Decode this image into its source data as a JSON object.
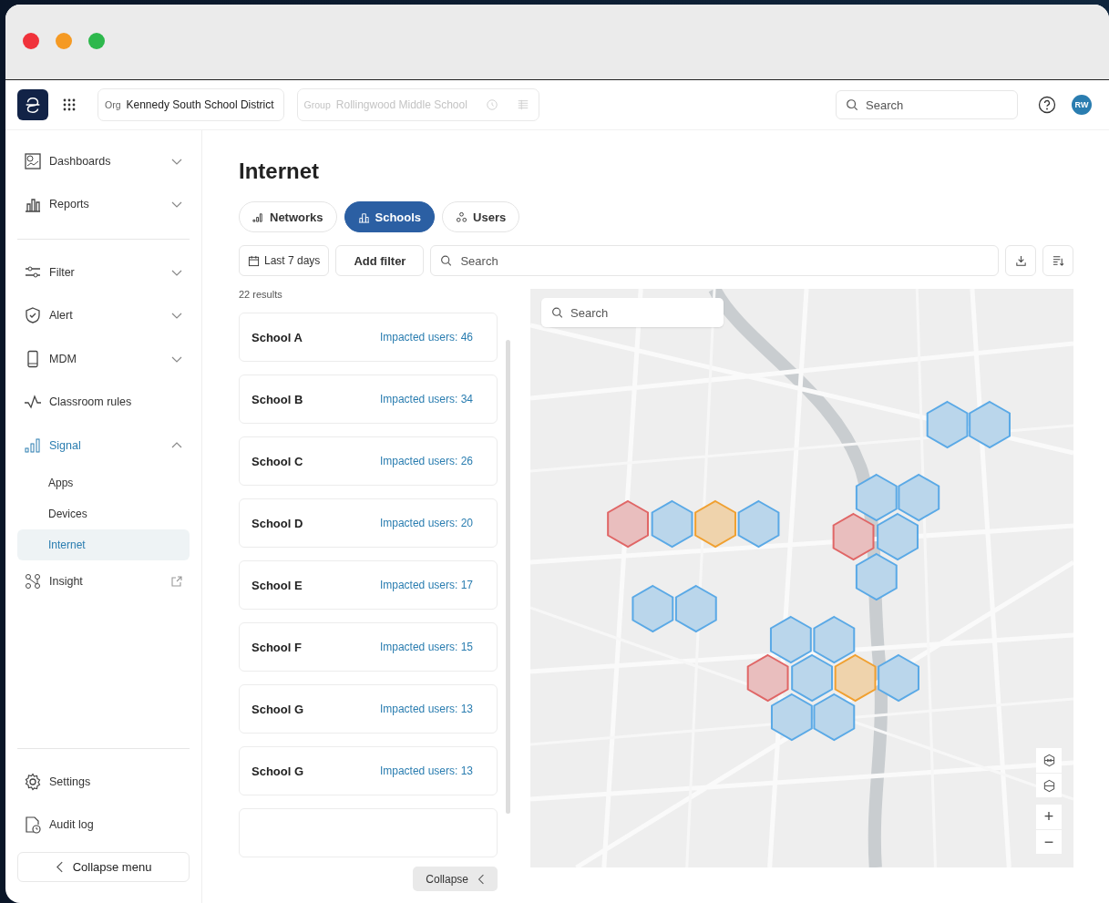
{
  "header": {
    "org": {
      "label": "Org",
      "value": "Kennedy South School District"
    },
    "group": {
      "label": "Group",
      "value": "Rollingwood Middle School",
      "disabled": true
    },
    "search": {
      "placeholder": "Search"
    },
    "avatar": "RW"
  },
  "sidebar": {
    "groups": [
      [
        {
          "label": "Dashboards",
          "kind": "dropdown",
          "expanded": false
        },
        {
          "label": "Reports",
          "kind": "dropdown",
          "expanded": false
        }
      ],
      [
        {
          "label": "Filter",
          "kind": "dropdown",
          "expanded": false
        },
        {
          "label": "Alert",
          "kind": "dropdown",
          "expanded": false
        },
        {
          "label": "MDM",
          "kind": "dropdown",
          "expanded": false
        },
        {
          "label": "Classroom rules",
          "kind": "plain"
        },
        {
          "label": "Signal",
          "kind": "dropdown",
          "expanded": true,
          "children": [
            {
              "label": "Apps",
              "selected": false
            },
            {
              "label": "Devices",
              "selected": false
            },
            {
              "label": "Internet",
              "selected": true
            }
          ]
        },
        {
          "label": "Insight",
          "kind": "external"
        }
      ]
    ],
    "footer": [
      {
        "label": "Settings"
      },
      {
        "label": "Audit log"
      }
    ],
    "collapse_button": "Collapse menu"
  },
  "page": {
    "title": "Internet",
    "tabs": [
      {
        "label": "Networks",
        "selected": false
      },
      {
        "label": "Schools",
        "selected": true
      },
      {
        "label": "Users",
        "selected": false
      }
    ],
    "toolbar": {
      "date_range": "Last 7 days",
      "add_filter": "Add filter",
      "search": {
        "placeholder": "Search"
      }
    },
    "results_count": "22 results",
    "schools": [
      {
        "name": "School A",
        "impacted": "Impacted users: 46"
      },
      {
        "name": "School B",
        "impacted": "Impacted users: 34"
      },
      {
        "name": "School C",
        "impacted": "Impacted users: 26"
      },
      {
        "name": "School D",
        "impacted": "Impacted users: 20"
      },
      {
        "name": "School E",
        "impacted": "Impacted users: 17"
      },
      {
        "name": "School F",
        "impacted": "Impacted users: 15"
      },
      {
        "name": "School G",
        "impacted": "Impacted users: 13"
      },
      {
        "name": "School G",
        "impacted": "Impacted users: 13"
      }
    ],
    "collapse_button": "Collapse",
    "map": {
      "search": {
        "placeholder": "Search"
      },
      "zoom_in": "+",
      "zoom_out": "−",
      "hexagons": [
        {
          "color": "#5aa9e6"
        },
        {
          "color": "#5aa9e6"
        },
        {
          "color": "#5aa9e6"
        },
        {
          "color": "#5aa9e6"
        },
        {
          "color": "#e06666"
        },
        {
          "color": "#5aa9e6"
        },
        {
          "color": "#f0a030"
        },
        {
          "color": "#5aa9e6"
        },
        {
          "color": "#e06666"
        },
        {
          "color": "#5aa9e6"
        },
        {
          "color": "#5aa9e6"
        },
        {
          "color": "#5aa9e6"
        },
        {
          "color": "#5aa9e6"
        },
        {
          "color": "#5aa9e6"
        },
        {
          "color": "#5aa9e6"
        },
        {
          "color": "#e06666"
        },
        {
          "color": "#5aa9e6"
        },
        {
          "color": "#f0a030"
        },
        {
          "color": "#5aa9e6"
        },
        {
          "color": "#5aa9e6"
        },
        {
          "color": "#5aa9e6"
        }
      ]
    }
  }
}
